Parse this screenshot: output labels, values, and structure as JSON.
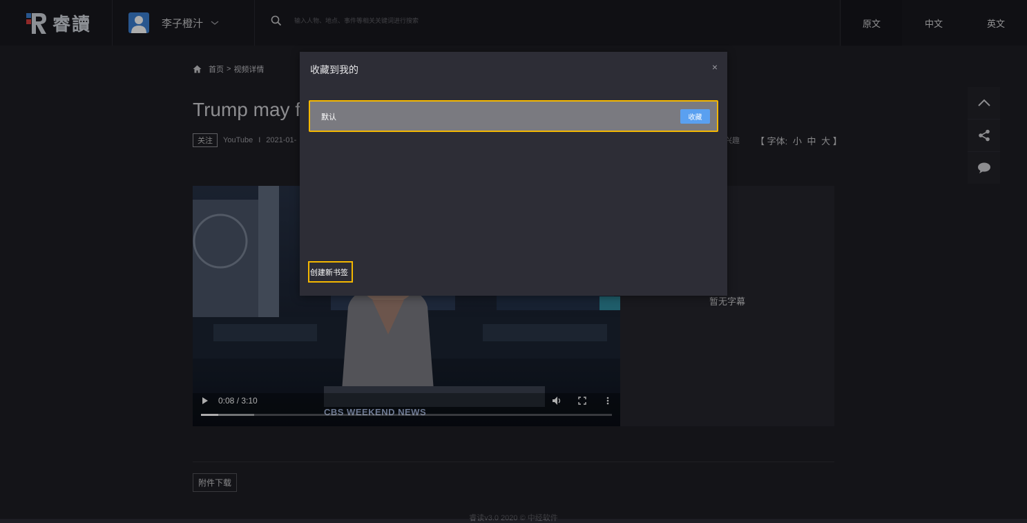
{
  "header": {
    "logo_text": "睿讀",
    "user": {
      "name": "李子橙汁"
    },
    "search": {
      "placeholder": "输入人物、地点、事件等相关关键词进行搜索"
    },
    "languages": [
      "原文",
      "中文",
      "英文"
    ]
  },
  "breadcrumb": {
    "home": "首页",
    "separator": ">",
    "current": "视频详情"
  },
  "article": {
    "title": "Trump may fa",
    "follow_label": "关注",
    "source": "YouTube",
    "divider": "I",
    "date": "2021-01-",
    "interest_label": "兴趣",
    "font_control": {
      "open": "【",
      "label": "字体:",
      "small": "小",
      "medium": "中",
      "large": "大",
      "close": "】"
    }
  },
  "video": {
    "time": "0:08 / 3:10",
    "banner": "CBS WEEKEND NEWS",
    "progress": 0.042,
    "buffered": 0.13
  },
  "subtitles": {
    "empty_text": "暂无字幕"
  },
  "attachment": {
    "label": "附件下载"
  },
  "footer": {
    "text": "睿读v3.0 2020 © 中经软件"
  },
  "modal": {
    "title": "收藏到我的",
    "close": "×",
    "folders": [
      {
        "name": "默认",
        "action": "收藏"
      }
    ],
    "create_label": "创建新书签"
  },
  "colors": {
    "accent": "#5aa0f0",
    "highlight": "#f5b800",
    "avatar": "#3b7fd1"
  }
}
